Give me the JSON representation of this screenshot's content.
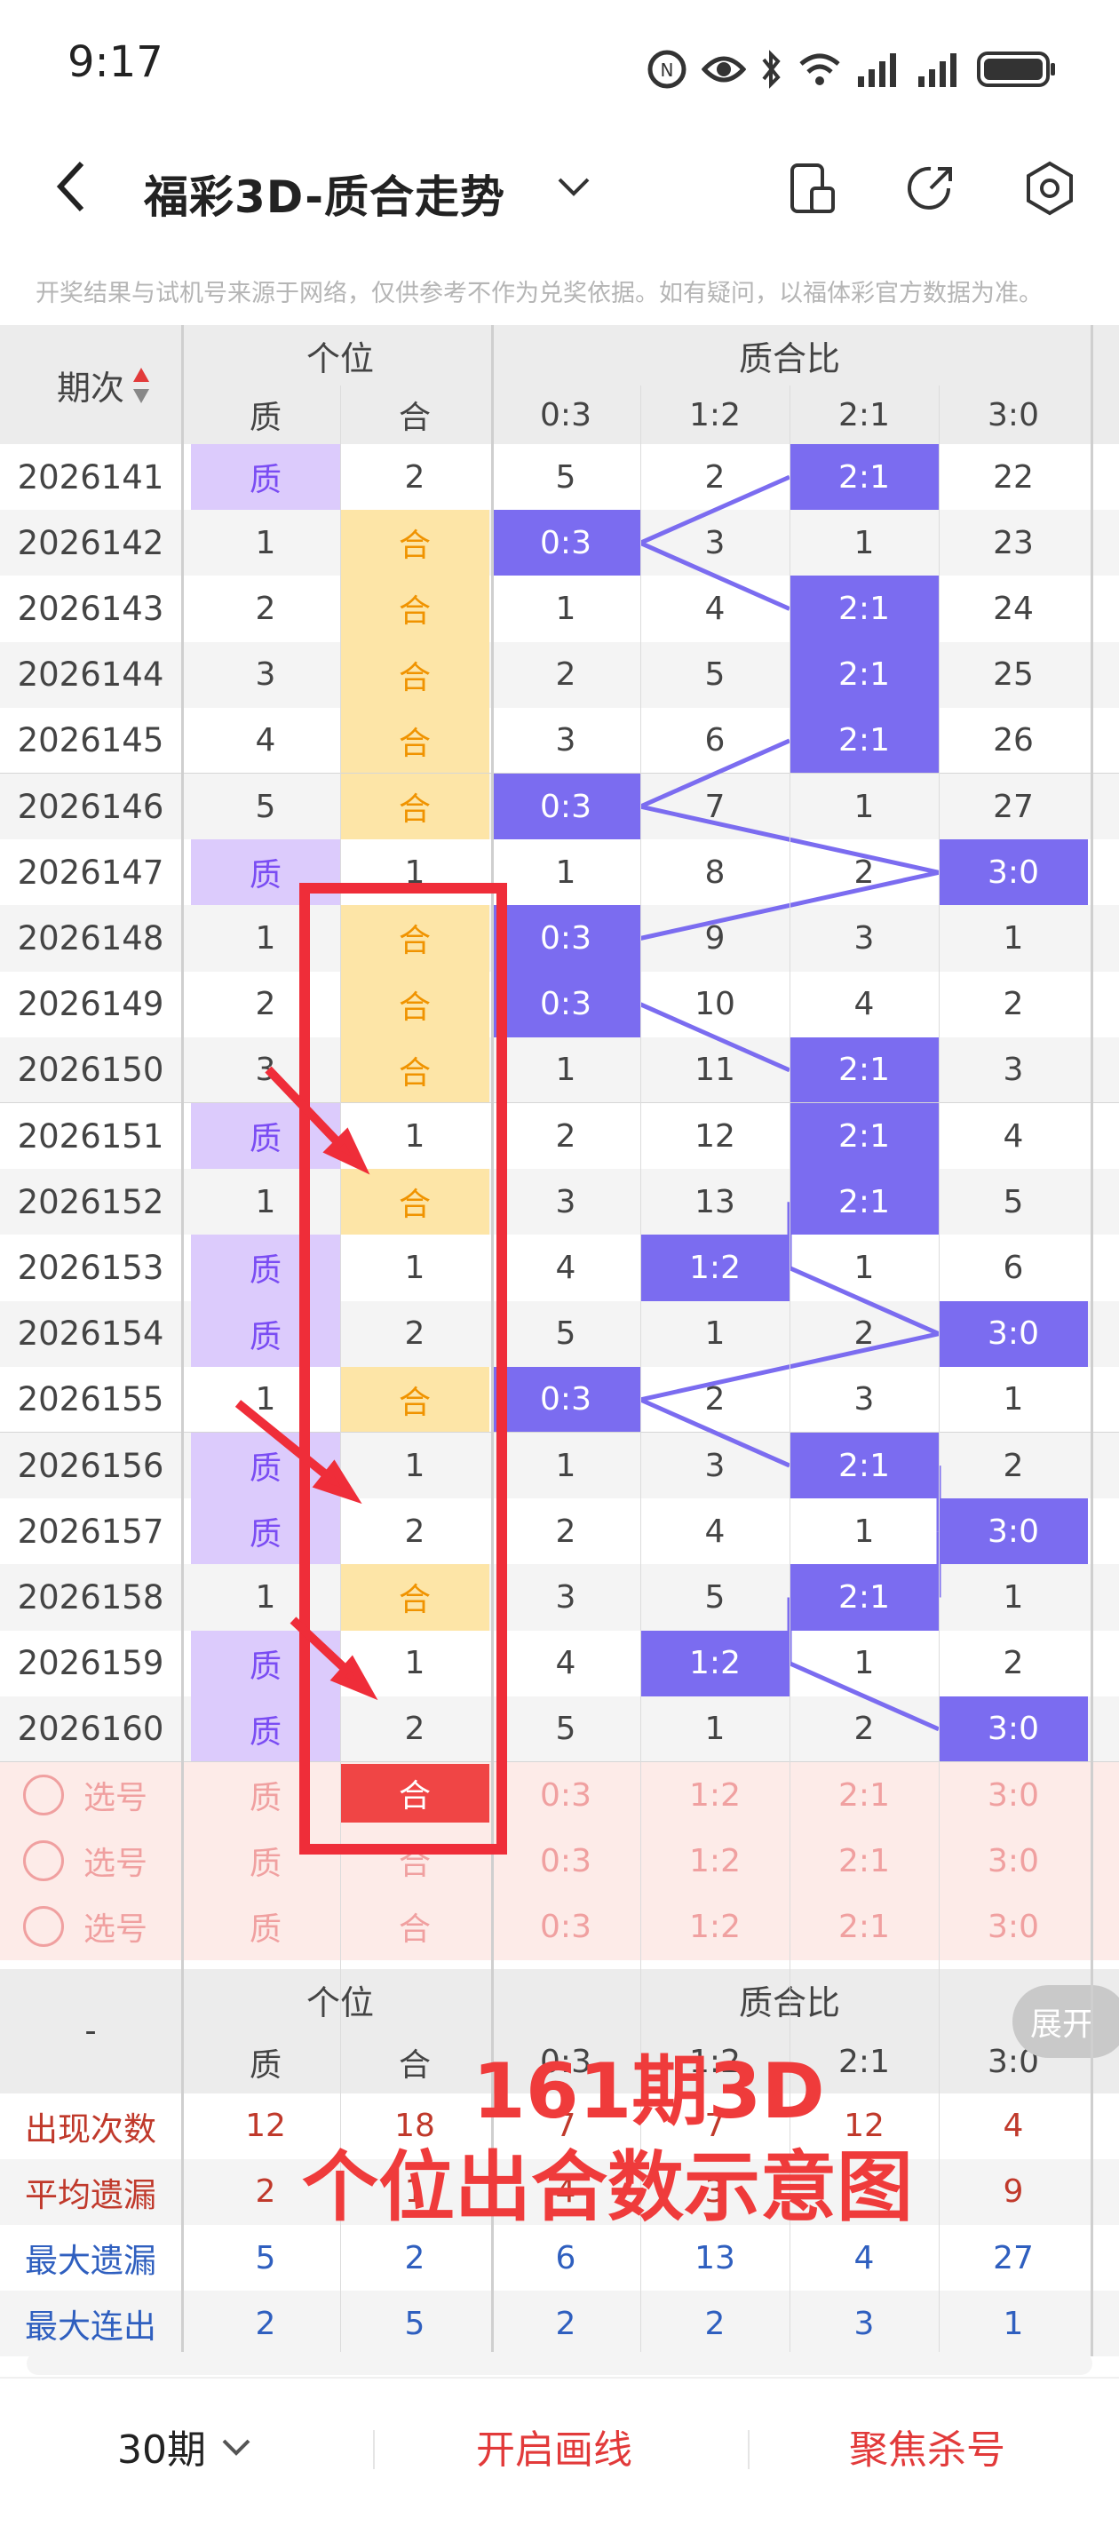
{
  "status": {
    "time": "9:17"
  },
  "header": {
    "title": "福彩3D-质合走势"
  },
  "notice": "开奖结果与试机号来源于网络，仅供参考不作为兑奖依据。如有疑问，以福体彩官方数据为准。",
  "table": {
    "period_header": "期次",
    "group1": "个位",
    "group2": "质合比",
    "sub1": [
      "质",
      "合"
    ],
    "sub2": [
      "0:3",
      "1:2",
      "2:1",
      "3:0"
    ],
    "rows": [
      {
        "p": "2026141",
        "c": [
          "质",
          "2",
          "5",
          "2",
          "2:1",
          "22"
        ]
      },
      {
        "p": "2026142",
        "c": [
          "1",
          "合",
          "0:3",
          "3",
          "1",
          "23"
        ]
      },
      {
        "p": "2026143",
        "c": [
          "2",
          "合",
          "1",
          "4",
          "2:1",
          "24"
        ]
      },
      {
        "p": "2026144",
        "c": [
          "3",
          "合",
          "2",
          "5",
          "2:1",
          "25"
        ]
      },
      {
        "p": "2026145",
        "c": [
          "4",
          "合",
          "3",
          "6",
          "2:1",
          "26"
        ]
      },
      {
        "p": "2026146",
        "c": [
          "5",
          "合",
          "0:3",
          "7",
          "1",
          "27"
        ]
      },
      {
        "p": "2026147",
        "c": [
          "质",
          "1",
          "1",
          "8",
          "2",
          "3:0"
        ]
      },
      {
        "p": "2026148",
        "c": [
          "1",
          "合",
          "0:3",
          "9",
          "3",
          "1"
        ]
      },
      {
        "p": "2026149",
        "c": [
          "2",
          "合",
          "0:3",
          "10",
          "4",
          "2"
        ]
      },
      {
        "p": "2026150",
        "c": [
          "3",
          "合",
          "1",
          "11",
          "2:1",
          "3"
        ]
      },
      {
        "p": "2026151",
        "c": [
          "质",
          "1",
          "2",
          "12",
          "2:1",
          "4"
        ]
      },
      {
        "p": "2026152",
        "c": [
          "1",
          "合",
          "3",
          "13",
          "2:1",
          "5"
        ]
      },
      {
        "p": "2026153",
        "c": [
          "质",
          "1",
          "4",
          "1:2",
          "1",
          "6"
        ]
      },
      {
        "p": "2026154",
        "c": [
          "质",
          "2",
          "5",
          "1",
          "2",
          "3:0"
        ]
      },
      {
        "p": "2026155",
        "c": [
          "1",
          "合",
          "0:3",
          "2",
          "3",
          "1"
        ]
      },
      {
        "p": "2026156",
        "c": [
          "质",
          "1",
          "1",
          "3",
          "2:1",
          "2"
        ]
      },
      {
        "p": "2026157",
        "c": [
          "质",
          "2",
          "2",
          "4",
          "1",
          "3:0"
        ]
      },
      {
        "p": "2026158",
        "c": [
          "1",
          "合",
          "3",
          "5",
          "2:1",
          "1"
        ]
      },
      {
        "p": "2026159",
        "c": [
          "质",
          "1",
          "4",
          "1:2",
          "1",
          "2"
        ]
      },
      {
        "p": "2026160",
        "c": [
          "质",
          "2",
          "5",
          "1",
          "2",
          "3:0"
        ]
      }
    ],
    "select_label": "选号",
    "select_rows": [
      [
        "质",
        "合",
        "0:3",
        "1:2",
        "2:1",
        "3:0"
      ],
      [
        "质",
        "合",
        "0:3",
        "1:2",
        "2:1",
        "3:0"
      ],
      [
        "质",
        "合",
        "0:3",
        "1:2",
        "2:1",
        "3:0"
      ]
    ],
    "stats_dash": "-",
    "stats": [
      {
        "label": "出现次数",
        "color": "#c0392b",
        "v": [
          "12",
          "18",
          "7",
          "7",
          "12",
          "4"
        ]
      },
      {
        "label": "平均遗漏",
        "color": "#c0392b",
        "v": [
          "2",
          "1",
          "4",
          "3",
          "",
          "9"
        ]
      },
      {
        "label": "最大遗漏",
        "color": "#2f5fbf",
        "v": [
          "5",
          "2",
          "6",
          "13",
          "4",
          "27"
        ]
      },
      {
        "label": "最大连出",
        "color": "#2f5fbf",
        "v": [
          "2",
          "5",
          "2",
          "2",
          "3",
          "1"
        ]
      }
    ],
    "expand_label": "展开"
  },
  "annotation": {
    "line1": "161期3D",
    "line2": "个位出合数示意图"
  },
  "footer": {
    "period": "30期",
    "draw": "开启画线",
    "focus": "聚焦杀号"
  },
  "colors": {
    "accent_purple": "#7b6cf0",
    "red": "#e8303a",
    "orange_cell": "#fde5a7",
    "lavender_cell": "#dccbfc"
  }
}
